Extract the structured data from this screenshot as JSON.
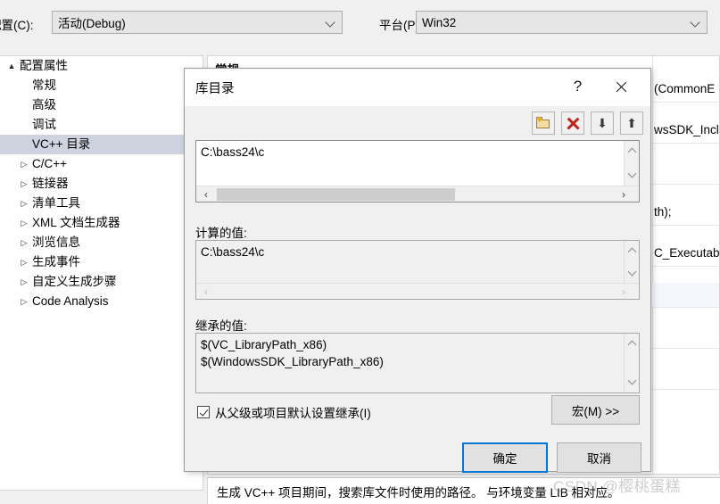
{
  "window": {
    "config_label": "配置(C):",
    "config_value": "活动(Debug)",
    "platform_label": "平台(P):",
    "platform_value": "Win32"
  },
  "sidebar": {
    "items": [
      {
        "label": "配置属性",
        "arrow": "▲",
        "level": 0,
        "selected": false,
        "expandable": true
      },
      {
        "label": "常规",
        "arrow": "",
        "level": 1,
        "selected": false,
        "expandable": false
      },
      {
        "label": "高级",
        "arrow": "",
        "level": 1,
        "selected": false,
        "expandable": false
      },
      {
        "label": "调试",
        "arrow": "",
        "level": 1,
        "selected": false,
        "expandable": false
      },
      {
        "label": "VC++ 目录",
        "arrow": "",
        "level": 1,
        "selected": true,
        "expandable": false
      },
      {
        "label": "C/C++",
        "arrow": "▷",
        "level": 1,
        "selected": false,
        "expandable": true
      },
      {
        "label": "链接器",
        "arrow": "▷",
        "level": 1,
        "selected": false,
        "expandable": true
      },
      {
        "label": "清单工具",
        "arrow": "▷",
        "level": 1,
        "selected": false,
        "expandable": true
      },
      {
        "label": "XML 文档生成器",
        "arrow": "▷",
        "level": 1,
        "selected": false,
        "expandable": true
      },
      {
        "label": "浏览信息",
        "arrow": "▷",
        "level": 1,
        "selected": false,
        "expandable": true
      },
      {
        "label": "生成事件",
        "arrow": "▷",
        "level": 1,
        "selected": false,
        "expandable": true
      },
      {
        "label": "自定义生成步骤",
        "arrow": "▷",
        "level": 1,
        "selected": false,
        "expandable": true
      },
      {
        "label": "Code Analysis",
        "arrow": "▷",
        "level": 1,
        "selected": false,
        "expandable": true
      }
    ]
  },
  "property_grid": {
    "header": "常规",
    "rows": [
      {
        "value": "(CommonE"
      },
      {
        "value": "wsSDK_Inclu"
      },
      {
        "value": ""
      },
      {
        "value": "th);"
      },
      {
        "value": "C_Executab"
      },
      {
        "value": ""
      },
      {
        "value": ""
      },
      {
        "value": ""
      }
    ]
  },
  "description": {
    "text": "生成 VC++ 项目期间，搜索库文件时使用的路径。 与环境变量 LIB 相对应。"
  },
  "dialog": {
    "title": "库目录",
    "help_label": "?",
    "toolbar": {
      "new_line_title": "新行",
      "delete_title": "删除",
      "move_down_title": "下移",
      "move_up_title": "上移",
      "move_down_glyph": "⬇",
      "move_up_glyph": "⬆",
      "star_glyph": "✦"
    },
    "editor": {
      "value": "C:\\bass24\\c"
    },
    "evaluated": {
      "label": "计算的值:",
      "value": "C:\\bass24\\c"
    },
    "inherited": {
      "label": "继承的值:",
      "value": "$(VC_LibraryPath_x86)\n$(WindowsSDK_LibraryPath_x86)"
    },
    "inherit_checkbox": {
      "label": "从父级或项目默认设置继承(I)",
      "checked": true
    },
    "macros_button": "宏(M) >>",
    "ok_button": "确定",
    "cancel_button": "取消",
    "scroll_left_glyph": "‹",
    "scroll_right_glyph": "›"
  },
  "watermark": {
    "text": "CSDN @樱桃蛋糕"
  }
}
